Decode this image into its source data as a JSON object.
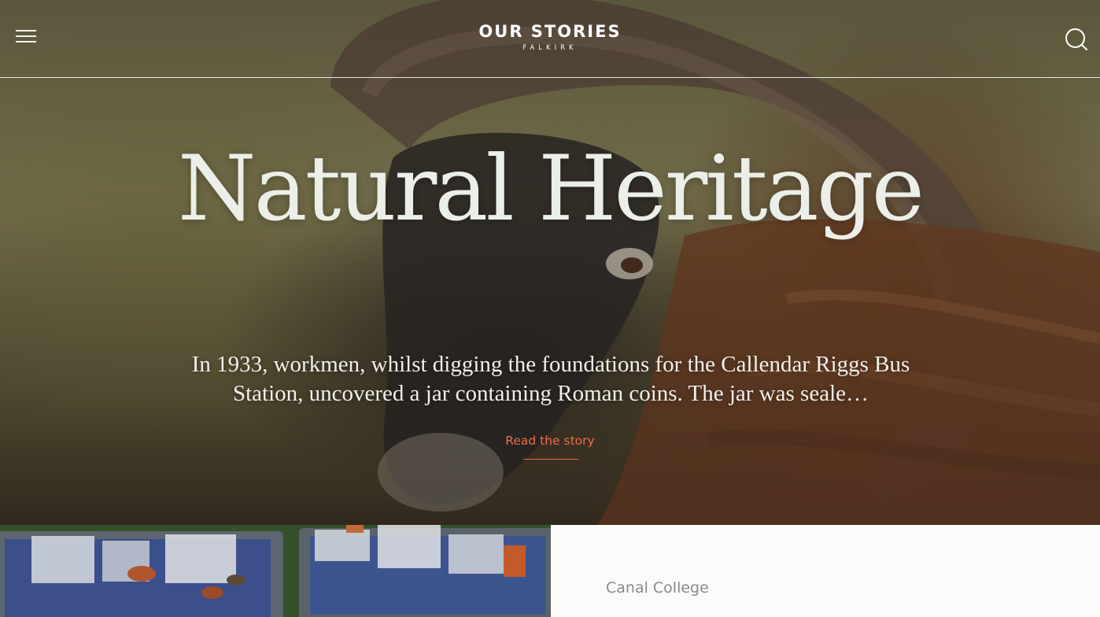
{
  "header": {
    "logo_main": "OUR STORIES",
    "logo_sub": "FALKIRK",
    "menu_icon": "hamburger-menu-icon",
    "search_icon": "search-icon"
  },
  "hero": {
    "title": "Natural Heritage",
    "excerpt": "In 1933, workmen, whilst digging the foundations for the Callendar Riggs Bus Station, uncovered a jar containing Roman coins. The jar was seale…",
    "cta_label": "Read the story",
    "image_subject": "ram with large curled horns",
    "accent_color": "#ee6b45",
    "title_color": "#eceee8"
  },
  "next_story": {
    "label": "Canal College",
    "image_subject": "crates of bagged archaeological finds"
  }
}
